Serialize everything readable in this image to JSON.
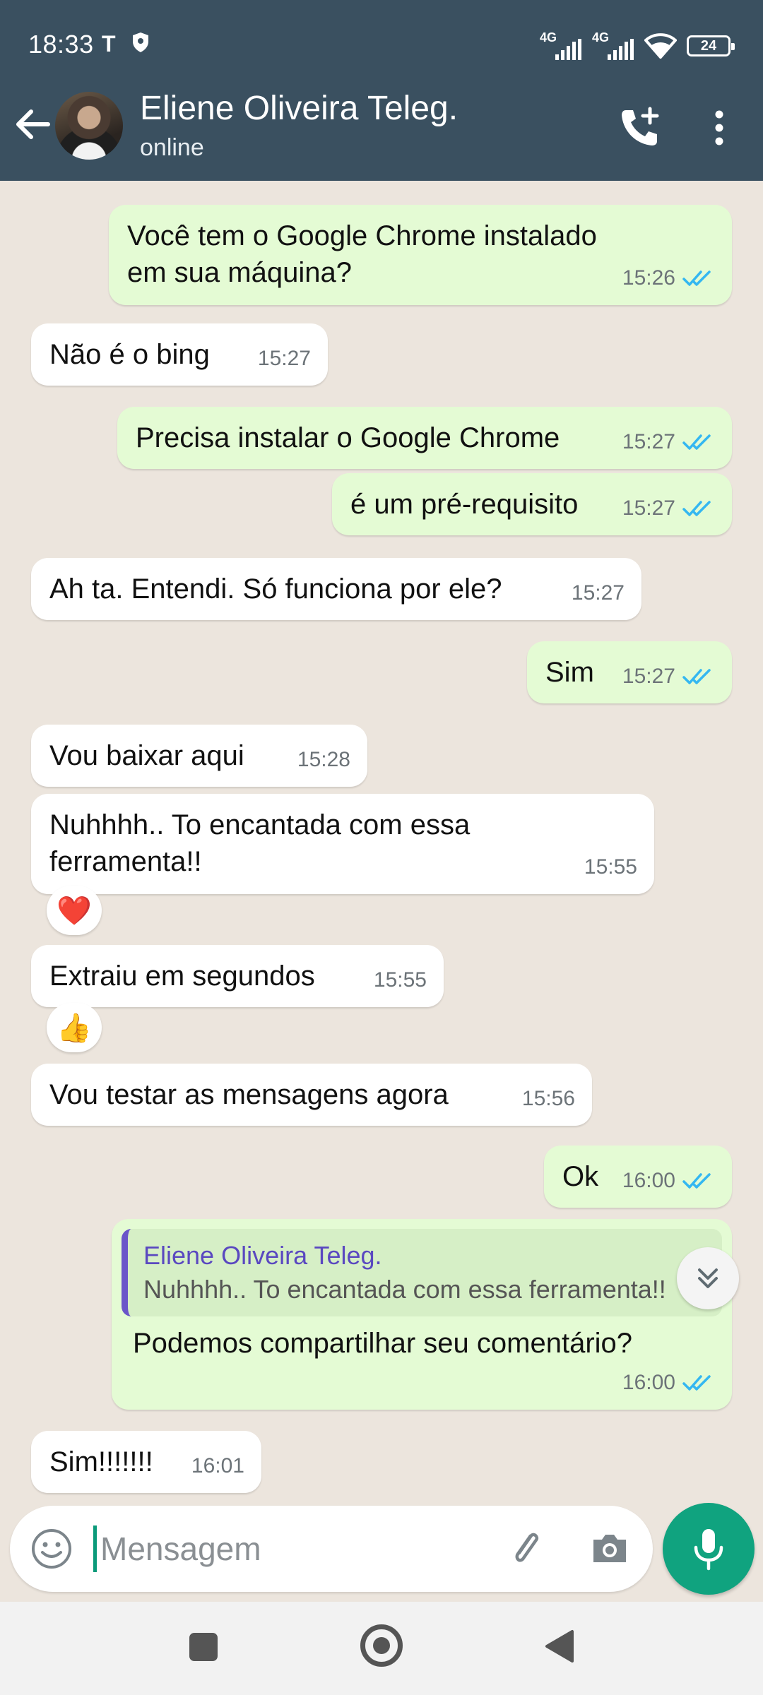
{
  "status_bar": {
    "time": "18:33",
    "left_icons": "T",
    "net1": "4G",
    "net2": "4G",
    "battery": "24"
  },
  "header": {
    "contact_name": "Eliene Oliveira Teleg.",
    "status": "online"
  },
  "messages": [
    {
      "dir": "out",
      "text": "Você tem o Google Chrome instalado em sua máquina?",
      "time": "15:26",
      "ticks": "read"
    },
    {
      "dir": "in",
      "text": "Não é o bing",
      "time": "15:27"
    },
    {
      "dir": "out",
      "text": "Precisa instalar o Google Chrome",
      "time": "15:27",
      "ticks": "read"
    },
    {
      "dir": "out",
      "text": "é um pré-requisito",
      "time": "15:27",
      "ticks": "read"
    },
    {
      "dir": "in",
      "text": "Ah ta. Entendi. Só funciona por ele?",
      "time": "15:27"
    },
    {
      "dir": "out",
      "text": "Sim",
      "time": "15:27",
      "ticks": "read"
    },
    {
      "dir": "in",
      "text": "Vou baixar aqui",
      "time": "15:28"
    },
    {
      "dir": "in",
      "text": "Nuhhhh.. To encantada com essa ferramenta!!",
      "time": "15:55",
      "reaction": "❤️"
    },
    {
      "dir": "in",
      "text": "Extraiu em segundos",
      "time": "15:55",
      "reaction": "👍"
    },
    {
      "dir": "in",
      "text": "Vou testar as mensagens agora",
      "time": "15:56"
    },
    {
      "dir": "out",
      "text": "Ok",
      "time": "16:00",
      "ticks": "read"
    },
    {
      "dir": "out",
      "text": "Podemos compartilhar seu comentário?",
      "time": "16:00",
      "ticks": "read",
      "quote": {
        "author": "Eliene Oliveira Teleg.",
        "text": "Nuhhhh.. To encantada com essa ferramenta!!"
      }
    },
    {
      "dir": "in",
      "text": "Sim!!!!!!!",
      "time": "16:01"
    }
  ],
  "composer": {
    "placeholder": "Mensagem"
  },
  "colors": {
    "header_bg": "#3a5060",
    "incoming_bubble": "#ffffff",
    "outgoing_bubble": "#e4fbd4",
    "read_tick": "#34b7f1",
    "mic_button": "#10a37f",
    "quote_accent": "#6a55c9"
  },
  "icons": [
    "back-arrow-icon",
    "add-call-icon",
    "more-vert-icon",
    "emoji-icon",
    "attach-icon",
    "camera-icon",
    "mic-icon",
    "double-chevron-down-icon",
    "read-ticks-icon"
  ]
}
